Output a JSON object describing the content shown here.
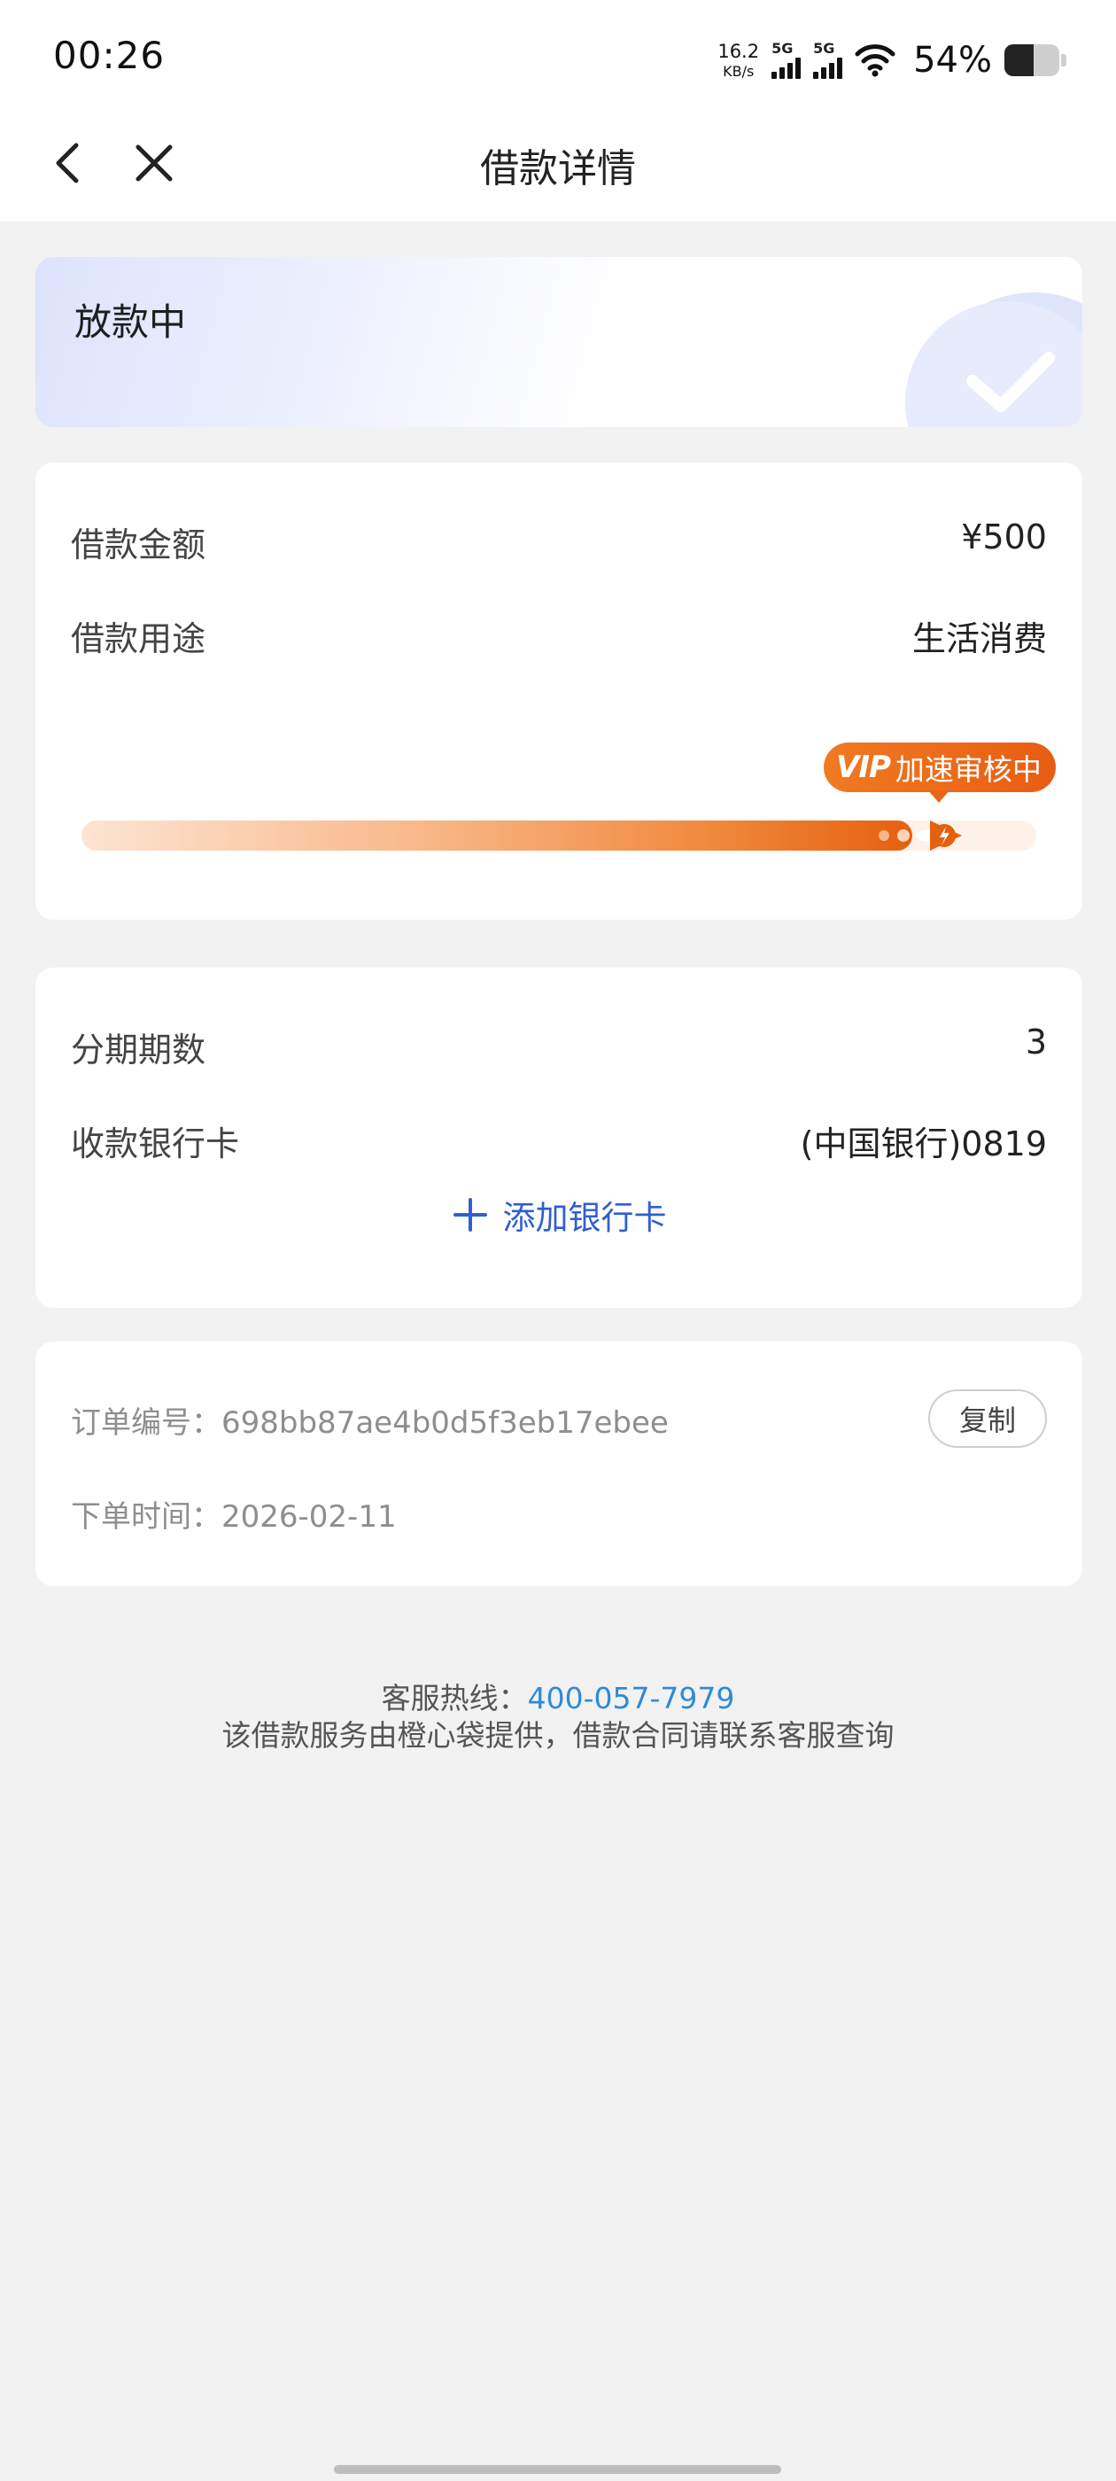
{
  "status_bar": {
    "time": "00:26",
    "net_speed": "16.2",
    "net_speed_unit": "KB/s",
    "sim1": "5G",
    "sim2": "5G",
    "battery": "54%"
  },
  "nav": {
    "title": "借款详情"
  },
  "status_card": {
    "status": "放款中"
  },
  "loan": {
    "amount_label": "借款金额",
    "amount_value": "¥500",
    "purpose_label": "借款用途",
    "purpose_value": "生活消费",
    "badge_vip": "VIP",
    "badge_text": "加速审核中",
    "progress": 0.87
  },
  "repayment": {
    "installments_label": "分期期数",
    "installments_value": "3",
    "bank_label": "收款银行卡",
    "bank_value": "(中国银行)0819",
    "add_card": "添加银行卡"
  },
  "order": {
    "number_line": "订单编号：698bb87ae4b0d5f3eb17ebee",
    "copy": "复制",
    "time_line": "下单时间：2026-02-11"
  },
  "footer": {
    "hotline_label": "客服热线：",
    "hotline_number": "400-057-7979",
    "note": "该借款服务由橙心袋提供，借款合同请联系客服查询"
  }
}
